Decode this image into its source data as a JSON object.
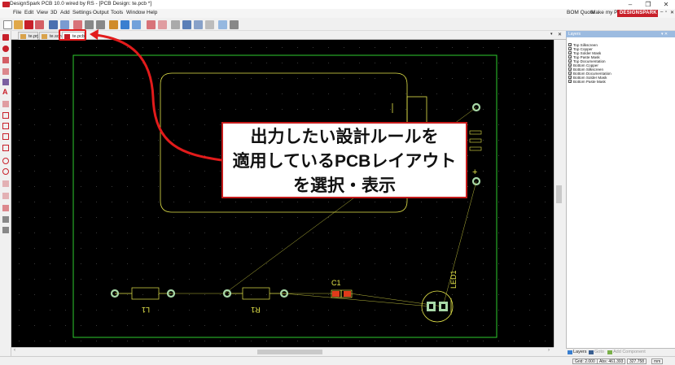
{
  "window": {
    "title": "DesignSpark PCB 10.0 wired by RS - [PCB Design: te.pcb *]",
    "minimize": "–",
    "maximize": "❐",
    "close": "✕"
  },
  "menu": {
    "items": [
      "File",
      "Edit",
      "View",
      "3D",
      "Add",
      "Settings",
      "Output",
      "Tools",
      "Window",
      "Help"
    ],
    "right": {
      "bom_quote": "BOM Quote",
      "make_pcb": "Make my PCB",
      "logo": "DESIGNSPARK"
    }
  },
  "tabs": [
    {
      "label": "te.prj",
      "active": false
    },
    {
      "label": "te.sch",
      "active": false
    },
    {
      "label": "te.pcb",
      "active": true
    }
  ],
  "pcb": {
    "components": {
      "l1": "L1",
      "r1": "R1",
      "c1": "C1",
      "led1": "LED1",
      "battery_plus": "+",
      "battery_minus": "I"
    }
  },
  "annotation": {
    "lines": [
      "出力したい設計ルールを",
      "適用しているPCBレイアウト",
      "を選択・表示"
    ]
  },
  "layers_panel": {
    "header": "Layers",
    "items": [
      {
        "label": "Top Silkscreen",
        "checked": true
      },
      {
        "label": "Top Copper",
        "checked": true
      },
      {
        "label": "Top Solder Mask",
        "checked": true
      },
      {
        "label": "Top Paste Mask",
        "checked": true
      },
      {
        "label": "Top Documentation",
        "checked": true
      },
      {
        "label": "Bottom Copper",
        "checked": true
      },
      {
        "label": "Bottom Silkscreen",
        "checked": true
      },
      {
        "label": "Bottom Documentation",
        "checked": true
      },
      {
        "label": "Bottom Solder Mask",
        "checked": true
      },
      {
        "label": "Bottom Paste Mask",
        "checked": true
      }
    ],
    "tabs": [
      "Layers",
      "Goto",
      "Add Component"
    ]
  },
  "status": {
    "grid": "Grid: 2.000",
    "abs": "Abs: 461.393",
    "coord": "327.758",
    "unit": "mm"
  },
  "colors": {
    "board_outline": "#2ecc2e",
    "silkscreen": "#e6e64a",
    "pad": "#a8d8a8",
    "ratsnest": "#e6e64a",
    "annotation_red": "#e21b1b"
  }
}
